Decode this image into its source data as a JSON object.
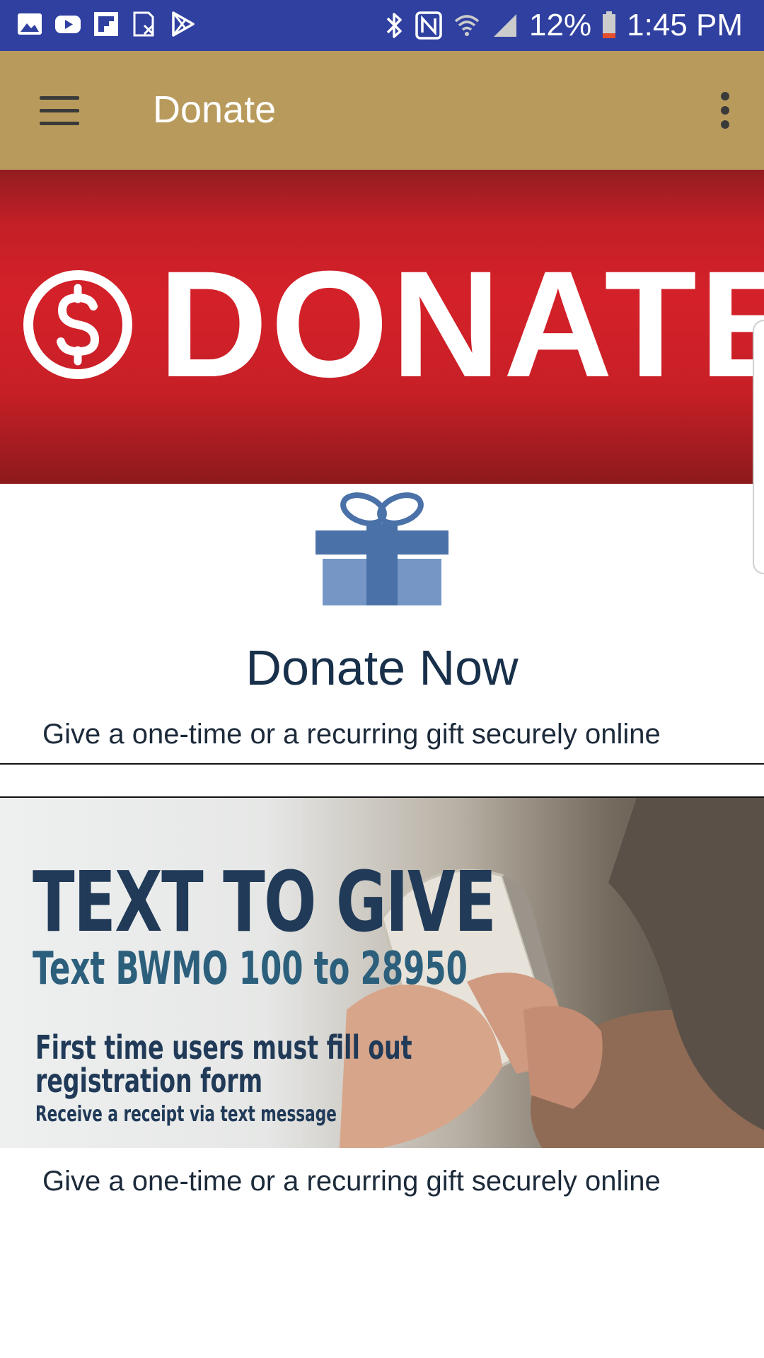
{
  "status_bar": {
    "battery_percent": "12%",
    "time": "1:45 PM",
    "left_icons": [
      "gallery-icon",
      "youtube-icon",
      "flipboard-icon",
      "sim-icon",
      "play-store-icon"
    ],
    "right_icons": [
      "bluetooth-icon",
      "nfc-icon",
      "wifi-icon",
      "signal-icon",
      "battery-icon"
    ],
    "color": "#3040a0"
  },
  "app_bar": {
    "title": "Donate",
    "menu_icon": "hamburger-menu-icon",
    "more_icon": "more-vert-icon",
    "color": "#b89b5c"
  },
  "banner": {
    "word": "DONATE",
    "icon": "dollar-coin-icon",
    "color": "#d42129"
  },
  "donate_now": {
    "icon": "gift-icon",
    "title": "Donate Now",
    "description": "Give a one-time or a recurring gift securely online"
  },
  "text_to_give": {
    "headline": "TEXT TO GIVE",
    "instruction": "Text BWMO 100 to 28950",
    "note_line1": "First time users must fill out",
    "note_line2": "registration form",
    "small_note": "Receive a receipt via text message",
    "description": "Give a one-time or a recurring gift securely online"
  }
}
